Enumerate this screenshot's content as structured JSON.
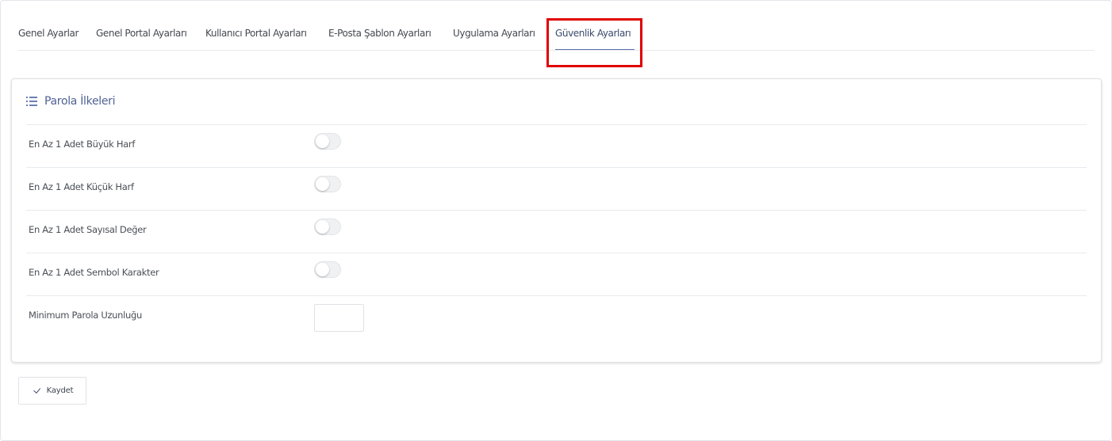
{
  "tabs": [
    {
      "label": "Genel Ayarlar"
    },
    {
      "label": "Genel Portal Ayarları"
    },
    {
      "label": "Kullanıcı Portal Ayarları"
    },
    {
      "label": "E-Posta Şablon Ayarları"
    },
    {
      "label": "Uygulama Ayarları"
    },
    {
      "label": "Güvenlik Ayarları",
      "active": true
    }
  ],
  "card": {
    "title": "Parola İlkeleri",
    "icon": "list-icon",
    "rows": [
      {
        "label": "En Az 1 Adet Büyük Harf",
        "type": "toggle",
        "on": false
      },
      {
        "label": "En Az 1 Adet Küçük Harf",
        "type": "toggle",
        "on": false
      },
      {
        "label": "En Az 1 Adet Sayısal Değer",
        "type": "toggle",
        "on": false
      },
      {
        "label": "En Az 1 Adet Sembol Karakter",
        "type": "toggle",
        "on": false
      },
      {
        "label": "Minimum Parola Uzunluğu",
        "type": "number",
        "value": ""
      }
    ]
  },
  "actions": {
    "save_label": "Kaydet",
    "save_icon": "check-icon"
  },
  "colors": {
    "accent": "#4f6294",
    "highlight": "#e00000"
  }
}
